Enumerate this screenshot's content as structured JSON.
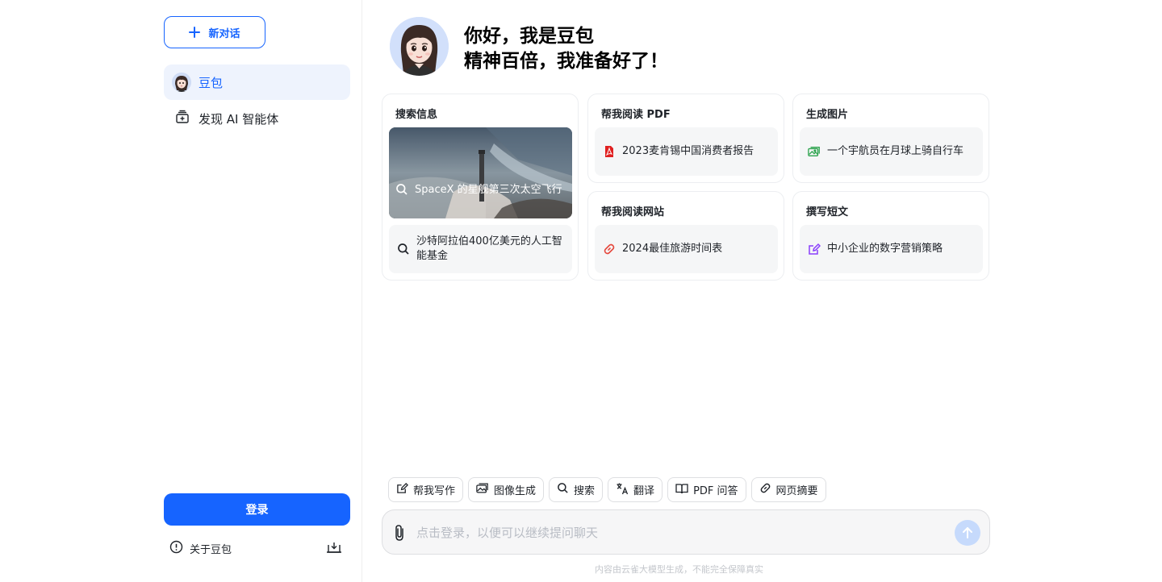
{
  "sidebar": {
    "new_chat_label": "新对话",
    "nav": [
      {
        "label": "豆包",
        "icon": "avatar-icon",
        "active": true
      },
      {
        "label": "发现 AI 智能体",
        "icon": "agent-store-icon",
        "active": false
      }
    ],
    "login_label": "登录",
    "about_label": "关于豆包"
  },
  "hero": {
    "line1": "你好，我是豆包",
    "line2": "精神百倍，我准备好了！"
  },
  "cards": [
    {
      "title": "搜索信息",
      "featured": {
        "text": "SpaceX 的星舰第三次太空飞行",
        "icon": "search-icon"
      },
      "items": [
        {
          "text": "沙特阿拉伯400亿美元的人工智能基金",
          "icon": "search-icon"
        }
      ]
    },
    {
      "title": "帮我阅读 PDF",
      "items": [
        {
          "text": "2023麦肯锡中国消费者报告",
          "icon": "pdf-icon"
        }
      ]
    },
    {
      "title": "生成图片",
      "items": [
        {
          "text": "一个宇航员在月球上骑自行车",
          "icon": "image-icon"
        }
      ]
    },
    {
      "title": "帮我阅读网站",
      "items": [
        {
          "text": "2024最佳旅游时间表",
          "icon": "link-icon"
        }
      ]
    },
    {
      "title": "撰写短文",
      "items": [
        {
          "text": "中小企业的数字营销策略",
          "icon": "edit-icon"
        }
      ]
    }
  ],
  "tools": [
    {
      "label": "帮我写作",
      "icon": "edit-icon"
    },
    {
      "label": "图像生成",
      "icon": "image-icon"
    },
    {
      "label": "搜索",
      "icon": "search-icon"
    },
    {
      "label": "翻译",
      "icon": "translate-icon"
    },
    {
      "label": "PDF 问答",
      "icon": "book-icon"
    },
    {
      "label": "网页摘要",
      "icon": "link-icon"
    }
  ],
  "input": {
    "placeholder": "点击登录，以便可以继续提问聊天",
    "value": ""
  },
  "disclaimer": "内容由云雀大模型生成，不能完全保障真实",
  "colors": {
    "accent": "#1664ff",
    "pdf": "#e02020",
    "image": "#2ea44f",
    "link": "#e5483d",
    "edit": "#8a3ffc"
  }
}
